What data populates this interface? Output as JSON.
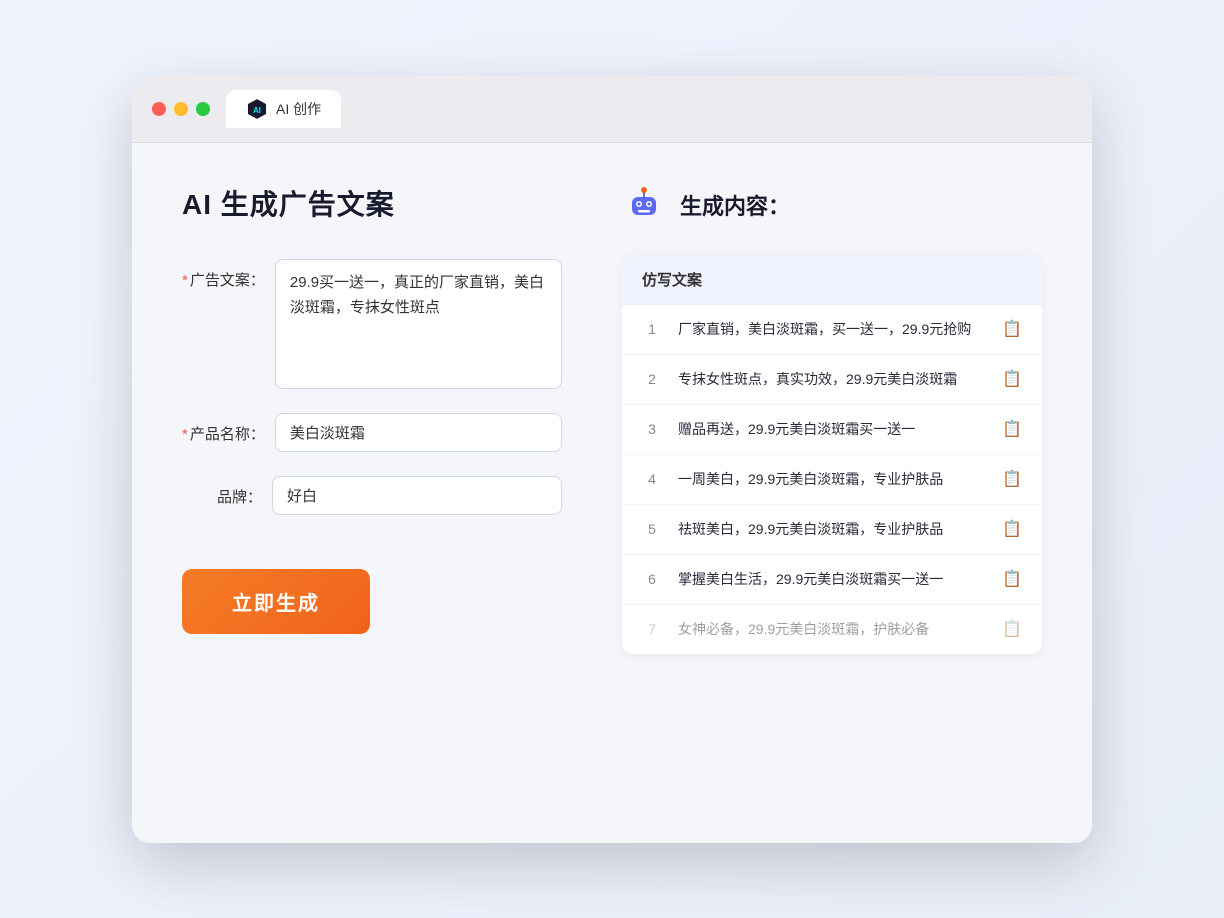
{
  "window": {
    "tab_label": "AI 创作"
  },
  "left_panel": {
    "title": "AI 生成广告文案",
    "form": {
      "ad_copy_label": "广告文案：",
      "ad_copy_required": "*",
      "ad_copy_value": "29.9买一送一，真正的厂家直销，美白淡斑霜，专抹女性斑点",
      "product_name_label": "产品名称：",
      "product_name_required": "*",
      "product_name_value": "美白淡斑霜",
      "brand_label": "品牌：",
      "brand_value": "好白"
    },
    "generate_button": "立即生成"
  },
  "right_panel": {
    "title": "生成内容：",
    "table_header": "仿写文案",
    "results": [
      {
        "num": "1",
        "text": "厂家直销，美白淡斑霜，买一送一，29.9元抢购",
        "faded": false
      },
      {
        "num": "2",
        "text": "专抹女性斑点，真实功效，29.9元美白淡斑霜",
        "faded": false
      },
      {
        "num": "3",
        "text": "赠品再送，29.9元美白淡斑霜买一送一",
        "faded": false
      },
      {
        "num": "4",
        "text": "一周美白，29.9元美白淡斑霜，专业护肤品",
        "faded": false
      },
      {
        "num": "5",
        "text": "祛斑美白，29.9元美白淡斑霜，专业护肤品",
        "faded": false
      },
      {
        "num": "6",
        "text": "掌握美白生活，29.9元美白淡斑霜买一送一",
        "faded": false
      },
      {
        "num": "7",
        "text": "女神必备，29.9元美白淡斑霜，护肤必备",
        "faded": true
      }
    ]
  },
  "colors": {
    "accent_orange": "#f0631a",
    "required_red": "#ff4d4f"
  }
}
